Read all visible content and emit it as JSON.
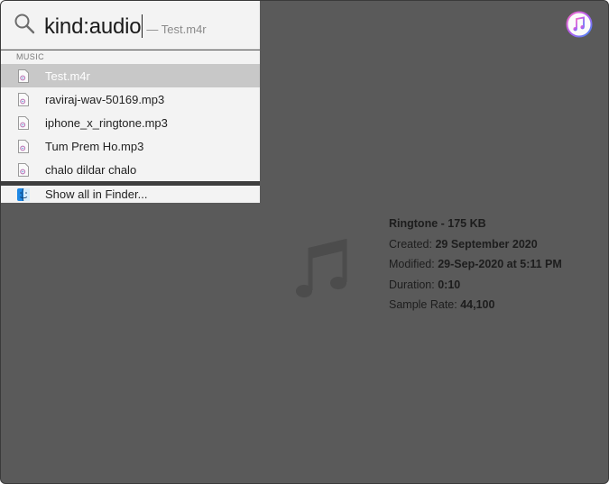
{
  "search": {
    "query": "kind:audio",
    "completion": "— Test.m4r"
  },
  "results": {
    "section_header": "MUSIC",
    "items": [
      {
        "label": "Test.m4r",
        "selected": true
      },
      {
        "label": "raviraj-wav-50169.mp3",
        "selected": false
      },
      {
        "label": "iphone_x_ringtone.mp3",
        "selected": false
      },
      {
        "label": "Tum Prem Ho.mp3",
        "selected": false
      },
      {
        "label": "chalo dildar chalo",
        "selected": false
      }
    ],
    "show_all": "Show all in Finder..."
  },
  "preview": {
    "kind_size": "Ringtone - 175 KB",
    "created_label": "Created:",
    "created_value": "29 September 2020",
    "modified_label": "Modified:",
    "modified_value": "29-Sep-2020 at 5:11 PM",
    "duration_label": "Duration:",
    "duration_value": "0:10",
    "sample_rate_label": "Sample Rate:",
    "sample_rate_value": "44,100"
  },
  "icons": {
    "search": "search-icon",
    "file": "audio-file-icon",
    "finder": "finder-icon",
    "itunes": "itunes-icon",
    "music_note": "music-note-icon"
  },
  "colors": {
    "panel_bg": "#f3f3f3",
    "selection": "#c8c8c8",
    "preview_bg": "#5a5a5a"
  }
}
